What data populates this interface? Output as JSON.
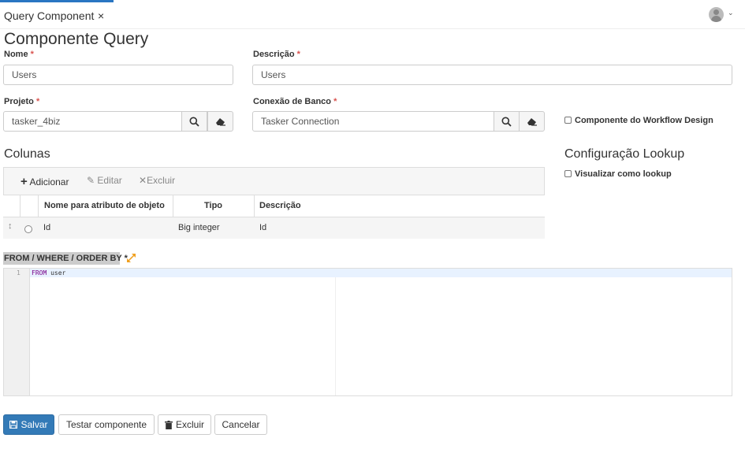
{
  "tab": {
    "label": "Query Component",
    "close": "×"
  },
  "page": {
    "title": "Componente Query"
  },
  "form": {
    "nome": {
      "label": "Nome",
      "required": "*",
      "value": "Users"
    },
    "descricao": {
      "label": "Descrição",
      "required": "*",
      "value": "Users"
    },
    "projeto": {
      "label": "Projeto",
      "required": "*",
      "value": "tasker_4biz"
    },
    "conexao": {
      "label": "Conexão de Banco",
      "required": "*",
      "value": "Tasker Connection"
    },
    "workflow_checkbox": {
      "label": "Componente do Workflow Design",
      "checked": false
    }
  },
  "colunas": {
    "title": "Colunas",
    "toolbar": {
      "add": "Adicionar",
      "edit": "Editar",
      "delete": "Excluir"
    },
    "headers": [
      "Nome para atributo de objeto",
      "Tipo",
      "Descrição"
    ],
    "rows": [
      {
        "nome": "Id",
        "tipo": "Big integer",
        "descricao": "Id"
      }
    ]
  },
  "lookup": {
    "title": "Configuração Lookup",
    "checkbox": {
      "label": "Visualizar como lookup",
      "checked": false
    }
  },
  "query": {
    "label": "FROM / WHERE / ORDER BY *",
    "lines": [
      {
        "number": "1",
        "keyword": "FROM",
        "text": "user"
      }
    ]
  },
  "actions": {
    "save": "Salvar",
    "test": "Testar componente",
    "delete": "Excluir",
    "cancel": "Cancelar"
  },
  "colors": {
    "primary": "#337ab7",
    "required": "#d9534f",
    "keyword": "#770088",
    "expand_icon": "#f0a020",
    "tab_accent": "#2a76c2"
  },
  "icons": [
    "search-icon",
    "eraser-icon",
    "plus-icon",
    "pencil-icon",
    "times-icon",
    "move-icon",
    "expand-icon",
    "save-icon",
    "trash-icon",
    "user-avatar-icon",
    "chevron-down-icon"
  ]
}
